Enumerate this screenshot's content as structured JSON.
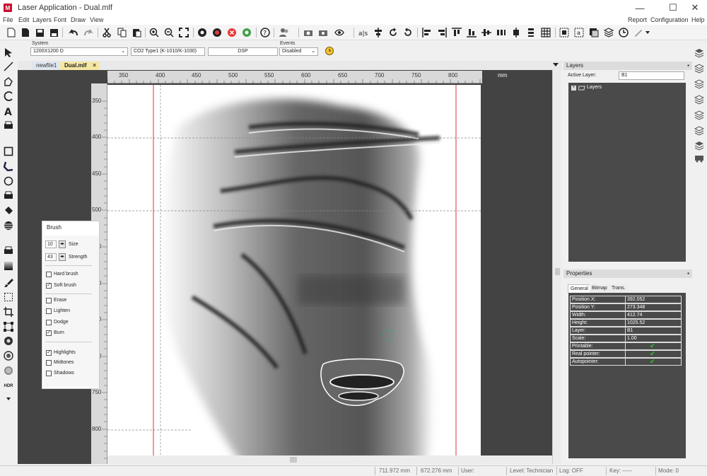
{
  "window": {
    "title": "Laser Application - Dual.mlf",
    "minimize": "—",
    "maximize": "☐",
    "close": "✕"
  },
  "menu": {
    "left": [
      "File",
      "Edit",
      "Layers",
      "Font",
      "Draw",
      "View"
    ],
    "right": [
      "Report",
      "Configuration",
      "Help"
    ]
  },
  "system": {
    "system_label": "System",
    "resolution": "1200X1200 D",
    "laser": "CO2 Type1 (K-1010/K-1030)",
    "dsp": "DSP",
    "events_label": "Events",
    "events_value": "Disabled"
  },
  "tabs": [
    {
      "label": "newfile1",
      "active": false
    },
    {
      "label": "Dual.mlf",
      "active": true,
      "close": "✕"
    }
  ],
  "ruler": {
    "unit": "mm",
    "h": [
      "350",
      "400",
      "450",
      "500",
      "550",
      "600",
      "650",
      "700",
      "750",
      "800"
    ],
    "v": [
      "350",
      "400",
      "450",
      "500",
      "550",
      "600",
      "650",
      "700",
      "750",
      "800"
    ]
  },
  "brush": {
    "title": "Brush",
    "size": {
      "value": "10",
      "label": "Size"
    },
    "strength": {
      "value": "43",
      "label": "Strength"
    },
    "options": [
      {
        "label": "Hard brush",
        "checked": false
      },
      {
        "label": "Soft brush",
        "checked": true
      },
      {
        "label": "Erase",
        "checked": false
      },
      {
        "label": "Lighten",
        "checked": false
      },
      {
        "label": "Dodge",
        "checked": false
      },
      {
        "label": "Burn",
        "checked": true
      },
      {
        "label": "Highlights",
        "checked": true
      },
      {
        "label": "Midtones",
        "checked": false
      },
      {
        "label": "Shadows",
        "checked": false
      }
    ]
  },
  "layers": {
    "title": "Layers",
    "active_label": "Active Layer:",
    "active_value": "B1",
    "tree_root": "Layers",
    "pin": "▪"
  },
  "properties": {
    "title": "Properties",
    "tabs": [
      "General",
      "Bitmap",
      "Trans."
    ],
    "rows": [
      {
        "key": "Position X:",
        "value": "392.052"
      },
      {
        "key": "Position Y:",
        "value": "273.348"
      },
      {
        "key": "Width:",
        "value": "412.74"
      },
      {
        "key": "Height:",
        "value": "1025.52"
      },
      {
        "key": "Layer:",
        "value": "B1"
      },
      {
        "key": "Scale:",
        "value": "1.00"
      },
      {
        "key": "Printable:",
        "value": "✔"
      },
      {
        "key": "Real pointer:",
        "value": "✔"
      },
      {
        "key": "Autopointer:",
        "value": "✔"
      }
    ]
  },
  "status": {
    "x": "711.972 mm",
    "y": "672.276 mm",
    "user": "User:",
    "level": "Level: Technician",
    "log": "Log: OFF",
    "key": "Key: -----",
    "mode": "Mode: 0"
  },
  "colors": {
    "accent": "#c8102e",
    "tab_active": "#f5e6a3",
    "canvas_bg": "#434343",
    "check": "#2fb12f"
  }
}
